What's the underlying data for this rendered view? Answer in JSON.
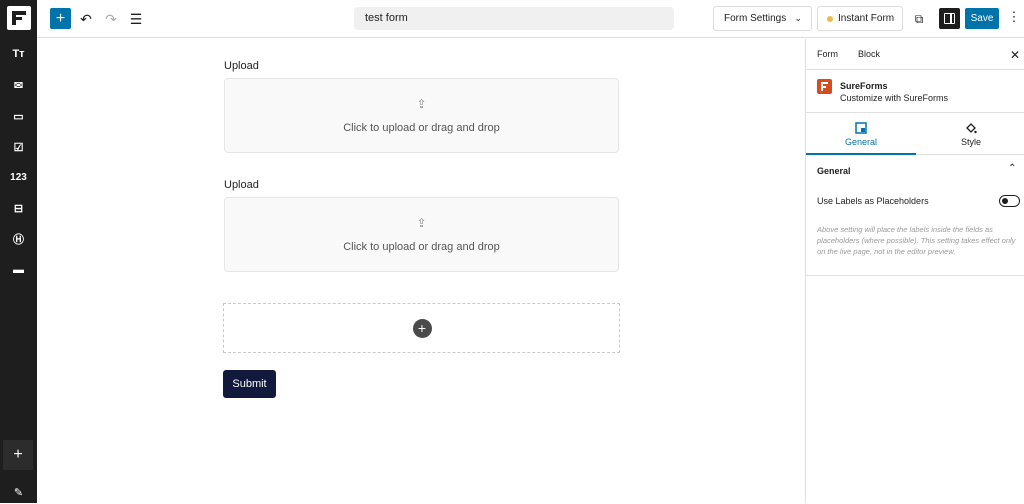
{
  "toolbar": {
    "add_icon": "plus-icon",
    "undo_icon": "undo-icon",
    "redo_icon": "redo-icon",
    "list_icon": "document-overview-icon",
    "title": "test form",
    "form_settings_label": "Form Settings",
    "instant_form_label": "Instant Form",
    "save_label": "Save"
  },
  "left_sidebar": {
    "items": [
      {
        "name": "text-field-icon",
        "glyph": "Tт"
      },
      {
        "name": "email-field-icon",
        "glyph": "✉"
      },
      {
        "name": "textarea-field-icon",
        "glyph": "▭"
      },
      {
        "name": "checkbox-field-icon",
        "glyph": "☑"
      },
      {
        "name": "number-field-icon",
        "glyph": "123"
      },
      {
        "name": "dropdown-field-icon",
        "glyph": "⊟"
      },
      {
        "name": "heading-field-icon",
        "glyph": "Ⓗ"
      },
      {
        "name": "payment-field-icon",
        "glyph": "▬"
      }
    ],
    "add_glyph": "+",
    "edit_glyph": "✎"
  },
  "form": {
    "fields": [
      {
        "label": "Upload",
        "prompt": "Click to upload or drag and drop"
      },
      {
        "label": "Upload",
        "prompt": "Click to upload or drag and drop"
      }
    ],
    "append_glyph": "+",
    "submit_label": "Submit"
  },
  "panel": {
    "tabs": [
      "Form",
      "Block"
    ],
    "brand_name": "SureForms",
    "brand_sub": "Customize with SureForms",
    "subtabs": [
      "General",
      "Style"
    ],
    "section_title": "General",
    "toggle_label": "Use Labels as Placeholders",
    "toggle_on": false,
    "help_text": "Above setting will place the labels inside the fields as placeholders (where possible). This setting takes effect only on the live page, not in the editor preview."
  },
  "colors": {
    "accent": "#0073aa",
    "submit": "#111a3d",
    "brand": "#d54e21"
  }
}
